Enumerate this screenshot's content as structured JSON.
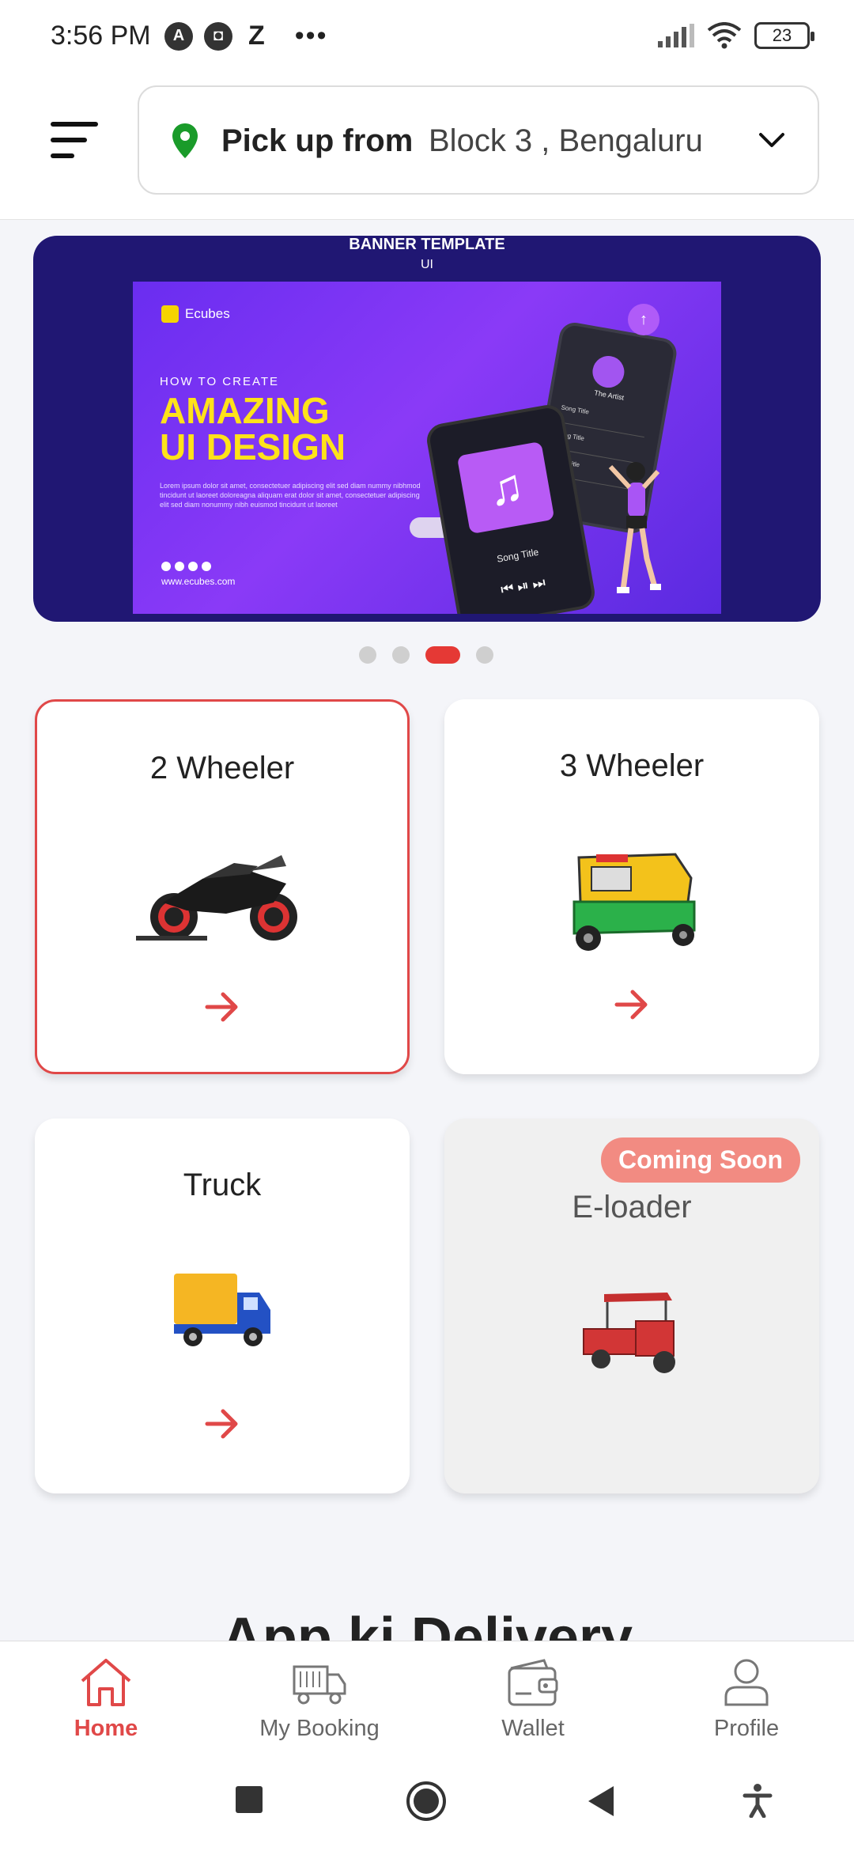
{
  "status": {
    "time": "3:56 PM",
    "battery": "23",
    "icons": [
      "a-circle-icon",
      "bag-icon",
      "z-icon",
      "more-dots-icon",
      "signal-icon",
      "wifi-icon",
      "battery-icon"
    ]
  },
  "header": {
    "menu_icon": "hamburger-menu-icon",
    "pick_label": "Pick up from",
    "pick_value": "Block 3 , Bengaluru",
    "pin_color": "#1a9b2a"
  },
  "banner": {
    "title": "BANNER TEMPLATE",
    "subtitle": "UI",
    "logo": "Ecubes",
    "how_to": "HOW TO CREATE",
    "headline_1": "AMAZING",
    "headline_2": "UI DESIGN",
    "body": "Lorem ipsum dolor sit amet, consectetuer adipiscing elit sed diam nummy nibhmod tincidunt ut laoreet doloreagna aliquam erat dolor sit amet, consectetuer adipiscing elit sed diam nonummy nibh euismod tincidunt ut laoreet",
    "url": "www.ecubes.com",
    "song_title": "Song Title",
    "artist": "The Artist",
    "playlist": [
      "Song Title",
      "Song Title",
      "Song Title"
    ],
    "slide_count": 4,
    "active_slide": 3
  },
  "vehicles": [
    {
      "title": "2 Wheeler",
      "selected": true,
      "coming_soon": false
    },
    {
      "title": "3 Wheeler",
      "selected": false,
      "coming_soon": false
    },
    {
      "title": "Truck",
      "selected": false,
      "coming_soon": false
    },
    {
      "title": "E-loader",
      "selected": false,
      "coming_soon": true,
      "badge": "Coming Soon"
    }
  ],
  "section_heading": "App ki Delivery",
  "nav": [
    {
      "label": "Home",
      "icon": "home-icon",
      "active": true
    },
    {
      "label": "My Booking",
      "icon": "truck-icon",
      "active": false
    },
    {
      "label": "Wallet",
      "icon": "wallet-icon",
      "active": false
    },
    {
      "label": "Profile",
      "icon": "profile-icon",
      "active": false
    }
  ],
  "colors": {
    "accent": "#e04848",
    "badge": "#f28b82",
    "banner_bg": "#201773"
  }
}
